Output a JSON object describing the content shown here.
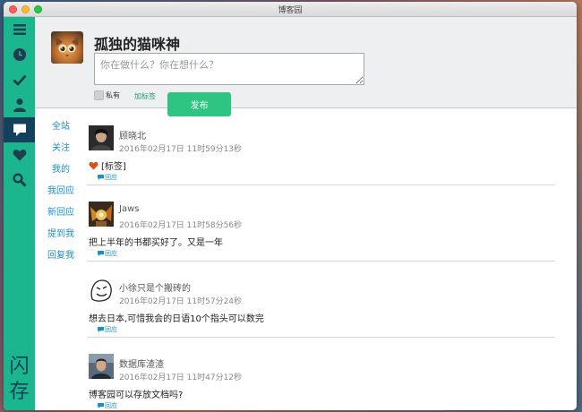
{
  "window": {
    "title": "博客园"
  },
  "sidebar": {
    "items": [
      {
        "icon": "menu-icon",
        "active": false
      },
      {
        "icon": "clock-icon",
        "active": false
      },
      {
        "icon": "check-icon",
        "active": false
      },
      {
        "icon": "user-icon",
        "active": false
      },
      {
        "icon": "message-icon",
        "active": true
      },
      {
        "icon": "heart-icon",
        "active": false
      },
      {
        "icon": "search-icon",
        "active": false
      }
    ],
    "flash_label": "闪存"
  },
  "compose": {
    "username": "孤独的猫咪神",
    "placeholder": "你在做什么？你在想什么？",
    "private_label": "私有",
    "tag_label": "加标签",
    "post_label": "发布"
  },
  "filters": [
    {
      "label": "全站"
    },
    {
      "label": "关注"
    },
    {
      "label": "我的"
    },
    {
      "label": "我回应"
    },
    {
      "label": "新回应"
    },
    {
      "label": "提到我"
    },
    {
      "label": "回复我"
    }
  ],
  "posts": [
    {
      "author": "顾晓北",
      "time": "2016年02月17日 11时59分13秒",
      "content": "[标签]",
      "reply_label": "回应"
    },
    {
      "author": "Jaws",
      "time": "2016年02月17日 11时58分56秒",
      "content": "把上半年的书都买好了。又是一年",
      "reply_label": "回应"
    },
    {
      "author": "小徐只是个搬砖的",
      "time": "2016年02月17日 11时57分24秒",
      "content": "想去日本,可惜我会的日语10个指头可以数完",
      "reply_label": "回应"
    },
    {
      "author": "数据库渣渣",
      "time": "2016年02月17日 11时47分12秒",
      "content": "博客园可以存放文档吗?",
      "reply_label": "回应"
    }
  ],
  "colors": {
    "sidebar": "#1bb58e",
    "sidebar_active": "#13405a",
    "accent_link": "#1c8fc4",
    "post_button": "#2ec482",
    "heart": "#d7521c"
  }
}
